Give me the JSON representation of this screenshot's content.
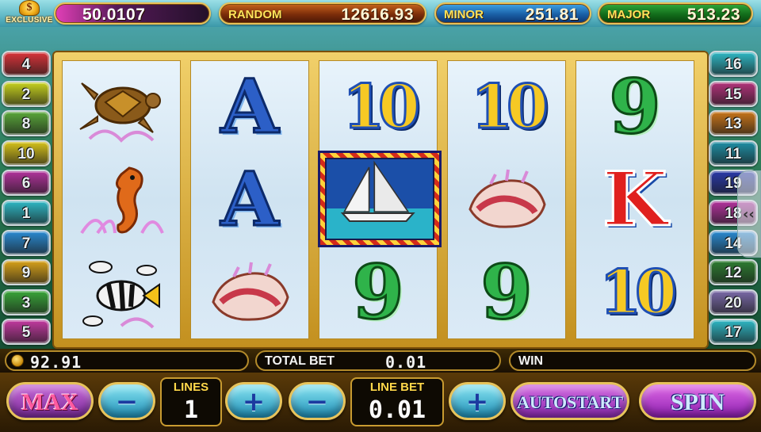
{
  "top_bar": {
    "logo_text": "EXCLUSIVE",
    "credit_value": "50.0107",
    "jackpots": [
      {
        "label": "RANDOM",
        "value": "12616.93"
      },
      {
        "label": "MINOR",
        "value": "251.81"
      },
      {
        "label": "MAJOR",
        "value": "513.23"
      }
    ]
  },
  "line_tabs_left": [
    {
      "number": "4",
      "color": "#d9343a"
    },
    {
      "number": "2",
      "color": "#c7d21e"
    },
    {
      "number": "8",
      "color": "#5aa83a"
    },
    {
      "number": "10",
      "color": "#d6c21a"
    },
    {
      "number": "6",
      "color": "#b2339c"
    },
    {
      "number": "1",
      "color": "#2fb7c4"
    },
    {
      "number": "7",
      "color": "#2a8ad1"
    },
    {
      "number": "9",
      "color": "#d8a21a"
    },
    {
      "number": "3",
      "color": "#3aa63a"
    },
    {
      "number": "5",
      "color": "#c33aa0"
    }
  ],
  "line_tabs_right": [
    {
      "number": "16",
      "color": "#2fb7c4"
    },
    {
      "number": "15",
      "color": "#b2337a"
    },
    {
      "number": "13",
      "color": "#c8751a"
    },
    {
      "number": "11",
      "color": "#1f8fa5"
    },
    {
      "number": "19",
      "color": "#2a3aa8"
    },
    {
      "number": "18",
      "color": "#b2339c"
    },
    {
      "number": "14",
      "color": "#2a8ad1"
    },
    {
      "number": "12",
      "color": "#2e7d32"
    },
    {
      "number": "20",
      "color": "#7a6aa8"
    },
    {
      "number": "17",
      "color": "#2fb7c4"
    }
  ],
  "reels": [
    [
      "turtle",
      "seahorse",
      "fish"
    ],
    [
      "A",
      "A",
      "conch-shell"
    ],
    [
      "10",
      "sailboat",
      "9"
    ],
    [
      "10",
      "conch-shell",
      "9"
    ],
    [
      "9",
      "K",
      "10"
    ]
  ],
  "highlighted_symbol": "sailboat",
  "info_bar": {
    "balance": "92.91",
    "total_bet_label": "TOTAL BET",
    "total_bet_value": "0.01",
    "win_label": "WIN",
    "win_value": ""
  },
  "controls": {
    "max_label": "MAX",
    "minus_symbol": "−",
    "plus_symbol": "+",
    "lines_label": "LINES",
    "lines_value": "1",
    "line_bet_label": "LINE BET",
    "line_bet_value": "0.01",
    "autostart_label": "AUTOSTART",
    "spin_label": "SPIN"
  },
  "side_handle_symbol": "‹‹"
}
